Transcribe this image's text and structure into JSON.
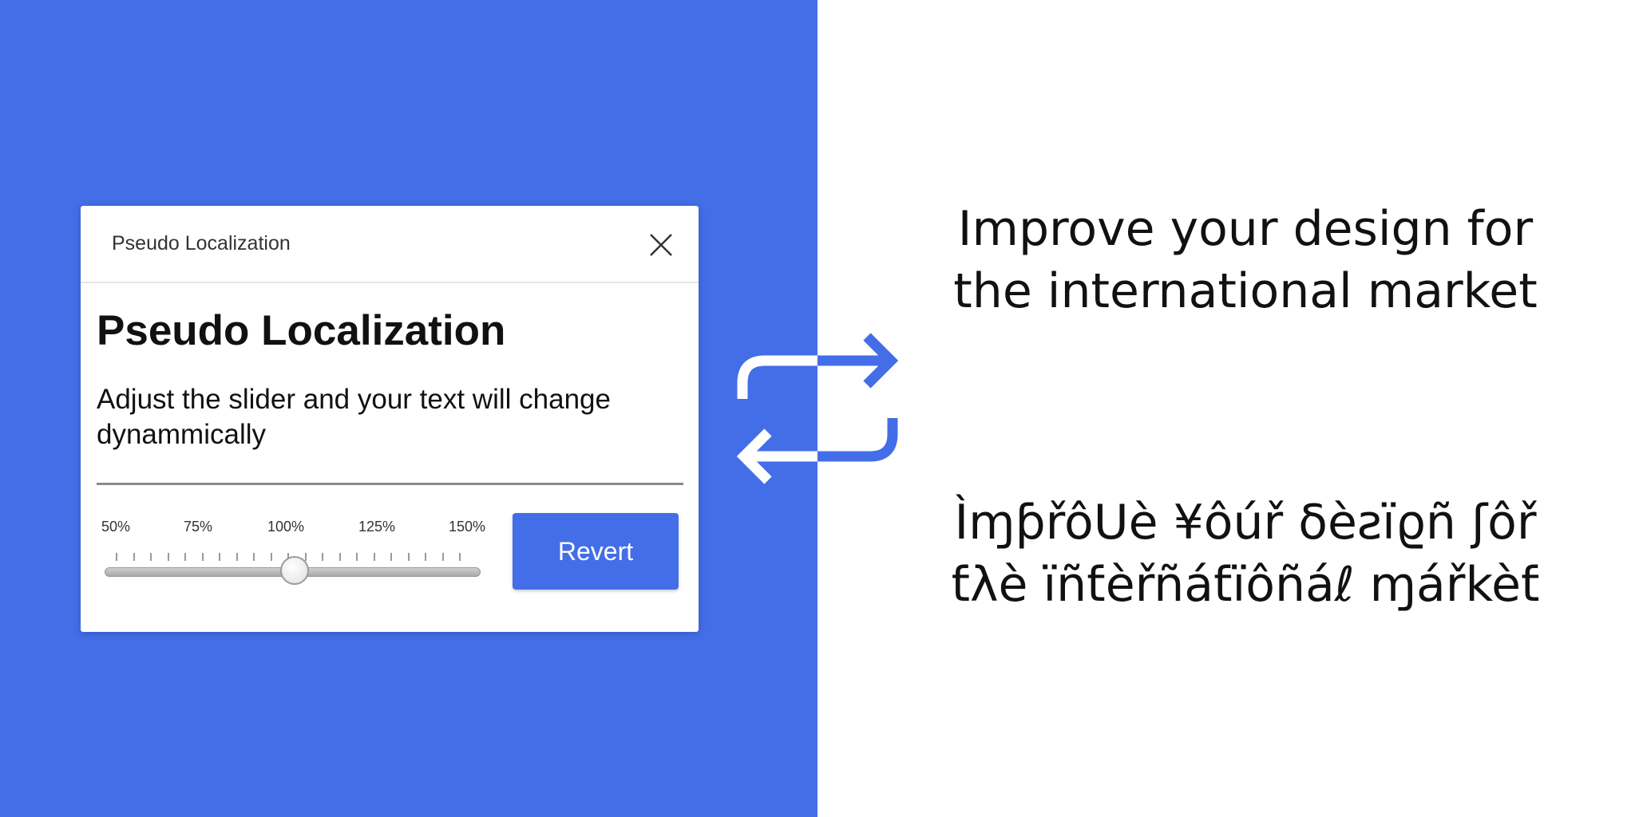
{
  "dialog": {
    "window_title": "Pseudo Localization",
    "heading": "Pseudo Localization",
    "description": "Adjust the slider and your text will change dynammically",
    "slider": {
      "tick_labels": [
        "50%",
        "75%",
        "100%",
        "125%",
        "150%"
      ],
      "min": 50,
      "max": 150,
      "value": 100
    },
    "revert_label": "Revert"
  },
  "promo": {
    "original_line1": "Improve your design for",
    "original_line2": "the international market",
    "pseudo_line1": "Ìɱƥřôᑌè ¥ôúř δèƨïϱñ ʃôř",
    "pseudo_line2": "ƭλè ïñƭèřñáƭïôñáℓ ɱářkèƭ"
  },
  "colors": {
    "accent": "#436ee8",
    "background": "#ffffff"
  },
  "icons": {
    "close": "close-icon",
    "swap": "swap-arrows-icon"
  }
}
